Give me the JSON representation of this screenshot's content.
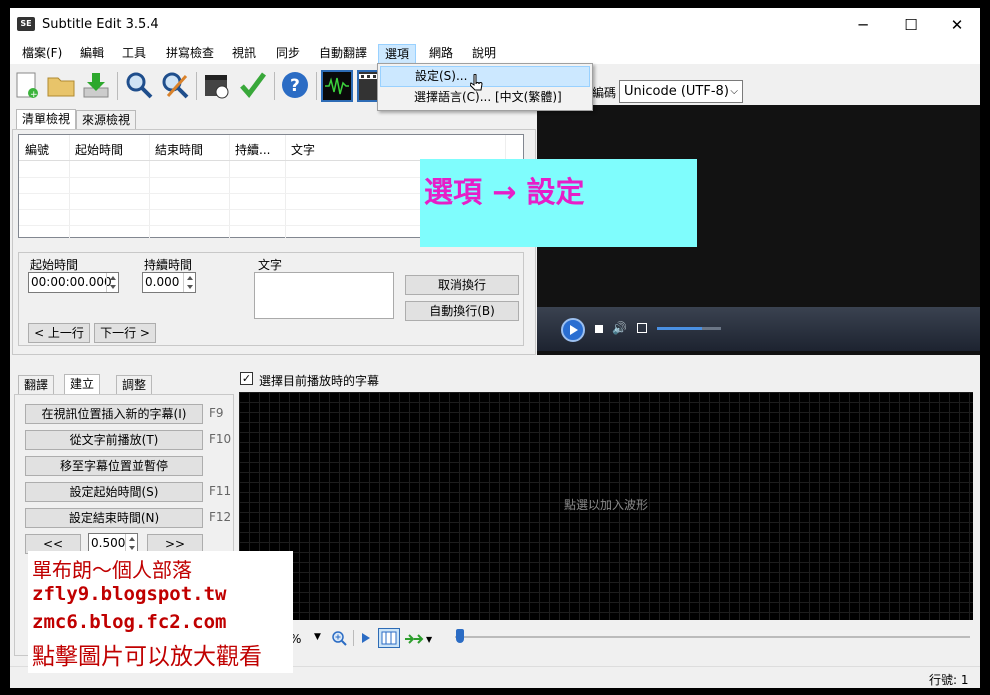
{
  "window": {
    "title": "Subtitle Edit 3.5.4",
    "app_icon_text": "SE",
    "minimize": "─",
    "maximize": "☐",
    "close": "✕"
  },
  "menu": [
    "檔案(F)",
    "編輯",
    "工具",
    "拼寫檢查",
    "視訊",
    "同步",
    "自動翻譯",
    "選項",
    "網路",
    "說明"
  ],
  "dropdown": {
    "items": [
      "設定(S)...",
      "選擇語言(C)... [中文(繁體)]"
    ]
  },
  "encoding": {
    "label": "編碼",
    "value": "Unicode (UTF-8)"
  },
  "top_tabs": [
    "清單檢視",
    "來源檢視"
  ],
  "list": {
    "columns": [
      "編號",
      "起始時間",
      "結束時間",
      "持續...",
      "文字"
    ]
  },
  "edit": {
    "start_label": "起始時間",
    "start_value": "00:00:00.000",
    "duration_label": "持續時間",
    "duration_value": "0.000",
    "text_label": "文字",
    "unbreak_button": "取消換行",
    "autobreak_button": "自動換行(B)",
    "prev_button": "< 上一行",
    "next_button": "下一行 >"
  },
  "bottom_tabs": [
    "翻譯",
    "建立",
    "調整"
  ],
  "create": {
    "buttons": [
      {
        "label": "在視訊位置插入新的字幕(I)",
        "key": "F9"
      },
      {
        "label": "從文字前播放(T)",
        "key": "F10"
      },
      {
        "label": "移至字幕位置並暫停",
        "key": ""
      },
      {
        "label": "設定起始時間(S)",
        "key": "F11"
      },
      {
        "label": "設定結束時間(N)",
        "key": "F12"
      }
    ],
    "back_button": "<<",
    "seconds_value": "0.500",
    "forward_button": ">>"
  },
  "waveform": {
    "checkbox_label": "選擇目前播放時的字幕",
    "placeholder": "點選以加入波形",
    "zoom_text": "%"
  },
  "status": {
    "line": "行號: 1"
  },
  "callout": {
    "text": "選項 → 設定"
  },
  "blog": {
    "line1": "單布朗～個人部落",
    "line2": "zfly9.blogspot.tw",
    "line3": "zmc6.blog.fc2.com",
    "line4": "點擊圖片可以放大觀看"
  },
  "colors": {
    "callout_bg": "#7ffdfd",
    "callout_text": "#e61ec8",
    "blog_text": "#c00000",
    "menu_highlight": "#cce8ff"
  }
}
